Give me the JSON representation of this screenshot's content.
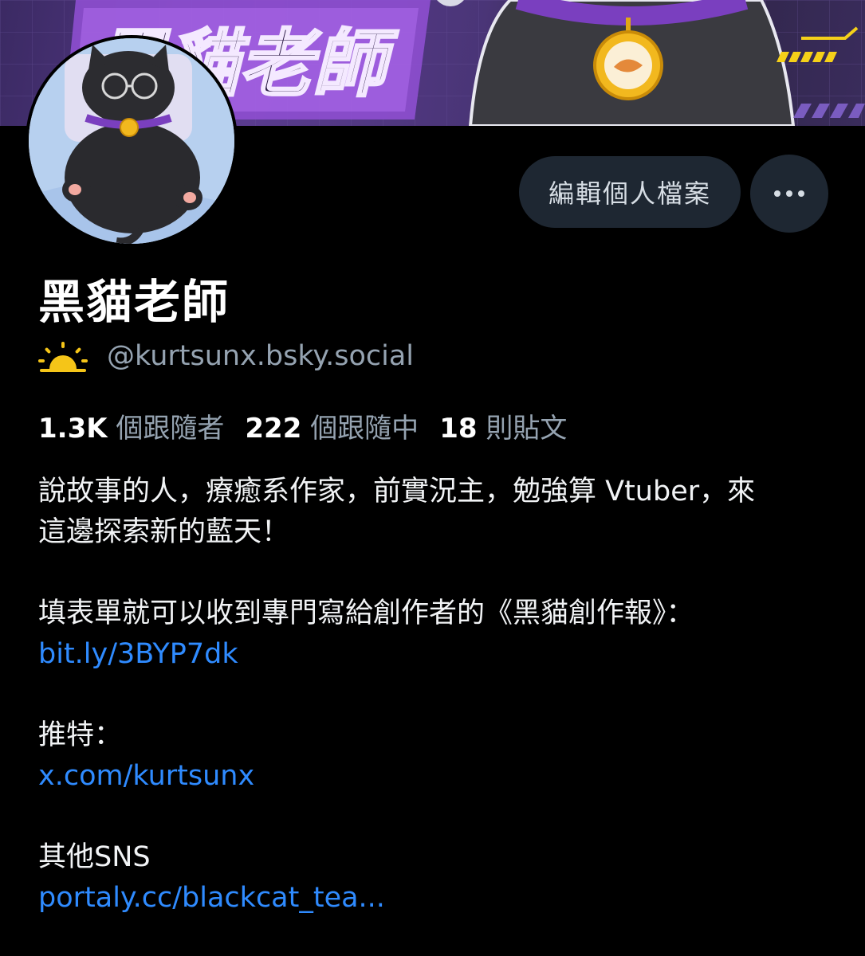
{
  "profile": {
    "display_name": "黑貓老師",
    "handle": "@kurtsunx.bsky.social",
    "handle_icon": "sun-icon",
    "edit_button_label": "編輯個人檔案",
    "more_icon": "more-horizontal-icon",
    "banner_title": "黑貓老師"
  },
  "stats": {
    "followers_count": "1.3K",
    "followers_label": "個跟隨者",
    "following_count": "222",
    "following_label": "個跟隨中",
    "posts_count": "18",
    "posts_label": "則貼文"
  },
  "bio": {
    "line1": "說故事的人，療癒系作家，前實況主，勉強算 Vtuber，來",
    "line2": "這邊探索新的藍天！",
    "newsletter_text": "填表單就可以收到專門寫給創作者的《黑貓創作報》：",
    "newsletter_link": "bit.ly/3BYP7dk",
    "twitter_label": "推特：",
    "twitter_link": "x.com/kurtsunx",
    "other_label": "其他SNS",
    "other_link": "portaly.cc/blackcat_tea..."
  },
  "colors": {
    "background": "#000000",
    "button_bg": "#1e2732",
    "link": "#2f8bff",
    "muted_text": "#95a3b1",
    "accent_yellow": "#f5c518",
    "banner_purple": "#5a3b8f"
  }
}
